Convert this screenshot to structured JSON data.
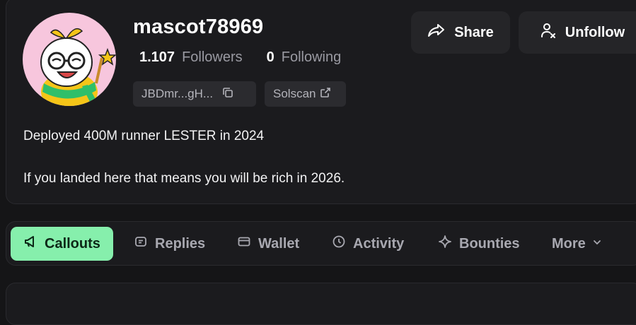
{
  "profile": {
    "username": "mascot78969",
    "followers_count": "1.107",
    "followers_label": "Followers",
    "following_count": "0",
    "following_label": "Following",
    "address": "JBDmr...gH...",
    "solscan_label": "Solscan",
    "bio_line1": "Deployed 400M runner LESTER in 2024",
    "bio_line2": "If you landed here that means you will be rich in 2026."
  },
  "actions": {
    "share_label": "Share",
    "unfollow_label": "Unfollow"
  },
  "tabs": [
    {
      "label": "Callouts",
      "icon": "megaphone-icon",
      "active": true
    },
    {
      "label": "Replies",
      "icon": "message-icon"
    },
    {
      "label": "Wallet",
      "icon": "wallet-icon"
    },
    {
      "label": "Activity",
      "icon": "clock-icon"
    },
    {
      "label": "Bounties",
      "icon": "sparkle-icon"
    },
    {
      "label": "More",
      "icon": "chevron-down-icon"
    }
  ],
  "colors": {
    "accent": "#86efac",
    "background": "#151517",
    "card": "#1b1b1e",
    "avatar_bg": "#f7c6dd"
  }
}
